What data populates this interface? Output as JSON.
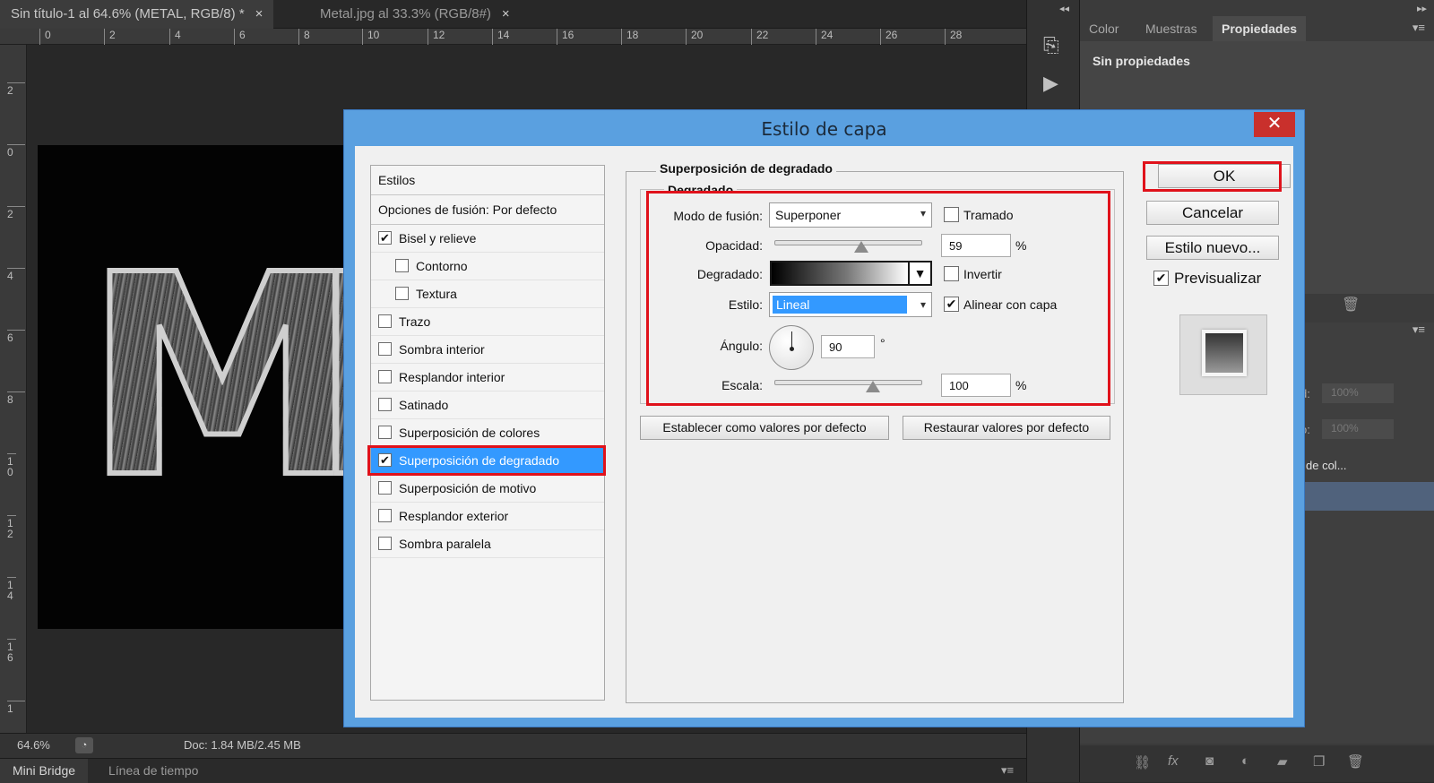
{
  "doc_tabs": [
    {
      "label": "Sin título-1 al 64.6% (METAL, RGB/8) *"
    },
    {
      "label": "Metal.jpg al 33.3% (RGB/8#)"
    }
  ],
  "close_glyph": "×",
  "ruler_h": [
    "0",
    "2",
    "4",
    "6",
    "8",
    "10",
    "12",
    "14",
    "16",
    "18",
    "20",
    "22",
    "24",
    "26",
    "28"
  ],
  "ruler_v": [
    "2",
    "0",
    "2",
    "4",
    "6",
    "8",
    "1 0",
    "1 2",
    "1 4",
    "1 6",
    "1"
  ],
  "canvas_letters": [
    "M",
    "M"
  ],
  "status": {
    "zoom": "64.6%",
    "doc": "Doc: 1.84 MB/2.45 MB"
  },
  "bottom_tabs": [
    "Mini Bridge",
    "Línea de tiempo"
  ],
  "panel": {
    "tabs": [
      "Color",
      "Muestras",
      "Propiedades"
    ],
    "active_tab": "Propiedades",
    "props_text": "Sin propiedades",
    "layers_fragments": [
      "d:",
      "100%",
      "o:",
      "100%",
      "de col..."
    ]
  },
  "dialog": {
    "title": "Estilo de capa",
    "close": "✕",
    "styles_header": "Estilos",
    "blend_options": "Opciones de fusión: Por defecto",
    "style_items": [
      {
        "label": "Bisel y relieve",
        "checked": "✔"
      },
      {
        "label": "Contorno",
        "checked": ""
      },
      {
        "label": "Textura",
        "checked": ""
      },
      {
        "label": "Trazo",
        "checked": ""
      },
      {
        "label": "Sombra interior",
        "checked": ""
      },
      {
        "label": "Resplandor interior",
        "checked": ""
      },
      {
        "label": "Satinado",
        "checked": ""
      },
      {
        "label": "Superposición de colores",
        "checked": ""
      },
      {
        "label": "Superposición de degradado",
        "checked": "✔"
      },
      {
        "label": "Superposición de motivo",
        "checked": ""
      },
      {
        "label": "Resplandor exterior",
        "checked": ""
      },
      {
        "label": "Sombra paralela",
        "checked": ""
      }
    ],
    "section_title": "Superposición de degradado",
    "subsection_title": "Degradado",
    "fields": {
      "blend_mode_label": "Modo de fusión:",
      "blend_mode_value": "Superponer",
      "dither_label": "Tramado",
      "dither_checked": "",
      "opacity_label": "Opacidad:",
      "opacity_value": "59",
      "percent": "%",
      "gradient_label": "Degradado:",
      "invert_label": "Invertir",
      "invert_checked": "",
      "style_label": "Estilo:",
      "style_value": "Lineal",
      "align_label": "Alinear con capa",
      "align_checked": "✔",
      "angle_label": "Ángulo:",
      "angle_value": "90",
      "degree": "°",
      "scale_label": "Escala:",
      "scale_value": "100"
    },
    "make_default": "Establecer como valores por defecto",
    "reset_default": "Restaurar valores por defecto",
    "ok": "OK",
    "cancel": "Cancelar",
    "new_style": "Estilo nuevo...",
    "preview_label": "Previsualizar",
    "preview_checked": "✔"
  },
  "colors": {
    "highlight_red": "#e0121b",
    "selection_blue": "#3399ff",
    "dialog_frame": "#5aa0e0"
  }
}
